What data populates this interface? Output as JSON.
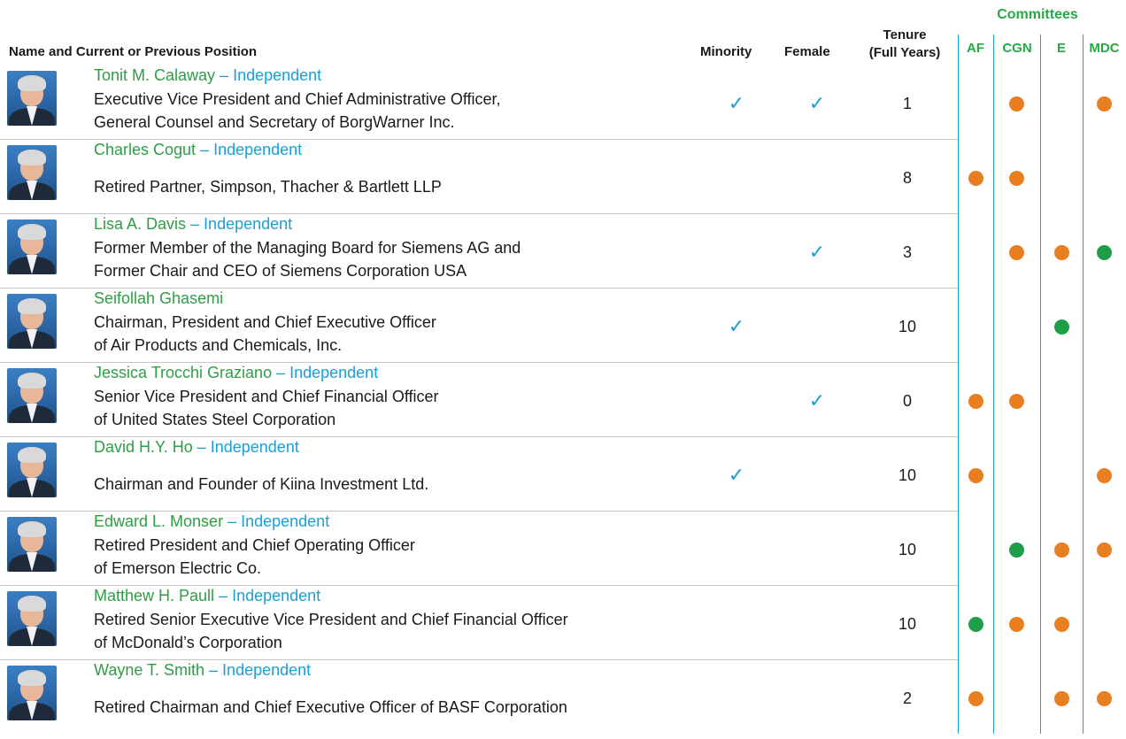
{
  "headers": {
    "name": "Name and Current or Previous Position",
    "minority": "Minority",
    "female": "Female",
    "tenure_line1": "Tenure",
    "tenure_line2": "(Full Years)",
    "committees": "Committees",
    "committee_cols": [
      "AF",
      "CGN",
      "E",
      "MDC"
    ]
  },
  "colors": {
    "name_green": "#2e9e45",
    "independent_blue": "#1a9fd6",
    "dot_orange": "#e87e1f",
    "dot_green": "#1e9e48",
    "divider_blue": "#1ba3d6"
  },
  "legend": {
    "orange_dot": "member",
    "green_dot": "chair"
  },
  "directors": [
    {
      "name": "Tonit M. Calaway",
      "independent": " – Independent",
      "desc": [
        "Executive Vice President and Chief Administrative Officer,",
        "General Counsel and Secretary of BorgWarner Inc."
      ],
      "minority": true,
      "female": true,
      "tenure": "1",
      "committees": {
        "AF": "",
        "CGN": "member",
        "E": "",
        "MDC": "member"
      }
    },
    {
      "name": "Charles Cogut",
      "independent": " – Independent",
      "desc": [
        "Retired Partner, Simpson, Thacher & Bartlett LLP"
      ],
      "minority": false,
      "female": false,
      "tenure": "8",
      "committees": {
        "AF": "member",
        "CGN": "member",
        "E": "",
        "MDC": ""
      }
    },
    {
      "name": "Lisa A. Davis",
      "independent": " – Independent",
      "desc": [
        "Former Member of the Managing Board for Siemens AG and",
        "Former Chair and CEO of Siemens Corporation USA"
      ],
      "minority": false,
      "female": true,
      "tenure": "3",
      "committees": {
        "AF": "",
        "CGN": "member",
        "E": "member",
        "MDC": "chair"
      }
    },
    {
      "name": "Seifollah Ghasemi",
      "independent": "",
      "desc": [
        "Chairman, President and Chief Executive Officer",
        "of Air Products and Chemicals, Inc."
      ],
      "minority": true,
      "female": false,
      "tenure": "10",
      "committees": {
        "AF": "",
        "CGN": "",
        "E": "chair",
        "MDC": ""
      }
    },
    {
      "name": "Jessica Trocchi Graziano",
      "independent": " – Independent",
      "desc": [
        "Senior Vice President and Chief Financial Officer",
        "of United States Steel Corporation"
      ],
      "minority": false,
      "female": true,
      "tenure": "0",
      "committees": {
        "AF": "member",
        "CGN": "member",
        "E": "",
        "MDC": ""
      }
    },
    {
      "name": "David H.Y. Ho",
      "independent": " – Independent",
      "desc": [
        "Chairman and Founder of Kiina Investment Ltd."
      ],
      "minority": true,
      "female": false,
      "tenure": "10",
      "committees": {
        "AF": "member",
        "CGN": "",
        "E": "",
        "MDC": "member"
      }
    },
    {
      "name": "Edward L. Monser",
      "independent": " – Independent",
      "desc": [
        "Retired President and Chief Operating Officer",
        "of Emerson Electric Co."
      ],
      "minority": false,
      "female": false,
      "tenure": "10",
      "committees": {
        "AF": "",
        "CGN": "chair",
        "E": "member",
        "MDC": "member"
      }
    },
    {
      "name": "Matthew H. Paull",
      "independent": " – Independent",
      "desc": [
        "Retired Senior Executive Vice President and Chief Financial Officer",
        "of McDonald’s Corporation"
      ],
      "minority": false,
      "female": false,
      "tenure": "10",
      "committees": {
        "AF": "chair",
        "CGN": "member",
        "E": "member",
        "MDC": ""
      }
    },
    {
      "name": "Wayne T. Smith",
      "independent": " – Independent",
      "desc": [
        "Retired Chairman and Chief Executive Officer of BASF Corporation"
      ],
      "minority": false,
      "female": false,
      "tenure": "2",
      "committees": {
        "AF": "member",
        "CGN": "",
        "E": "member",
        "MDC": "member"
      }
    }
  ]
}
